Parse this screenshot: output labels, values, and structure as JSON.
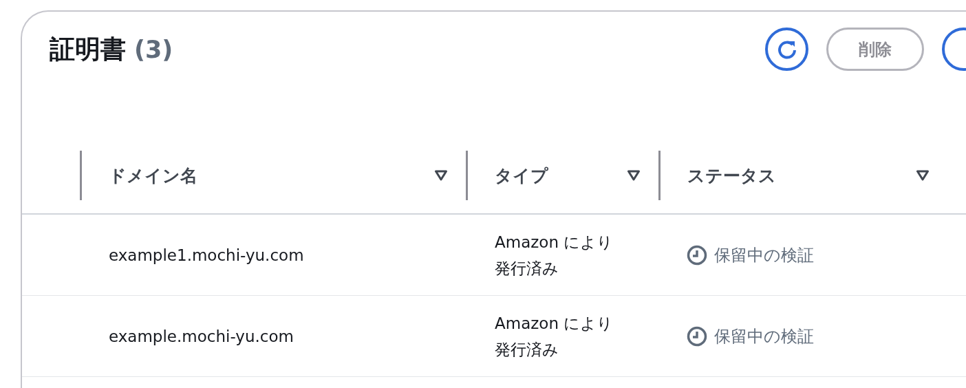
{
  "header": {
    "title": "証明書",
    "count": "(3)"
  },
  "actions": {
    "delete": {
      "label": "削除",
      "disabled": true
    }
  },
  "table": {
    "columns": [
      {
        "label": "ドメイン名"
      },
      {
        "label": "タイプ"
      },
      {
        "label": "ステータス"
      }
    ],
    "rows": [
      {
        "domain": "example1.mochi-yu.com",
        "type": [
          "Amazon により",
          "発行済み"
        ],
        "status": {
          "kind": "pending",
          "label": "保留中の検証"
        }
      },
      {
        "domain": "example.mochi-yu.com",
        "type": [
          "Amazon により",
          "発行済み"
        ],
        "status": {
          "kind": "pending",
          "label": "保留中の検証"
        }
      }
    ]
  }
}
